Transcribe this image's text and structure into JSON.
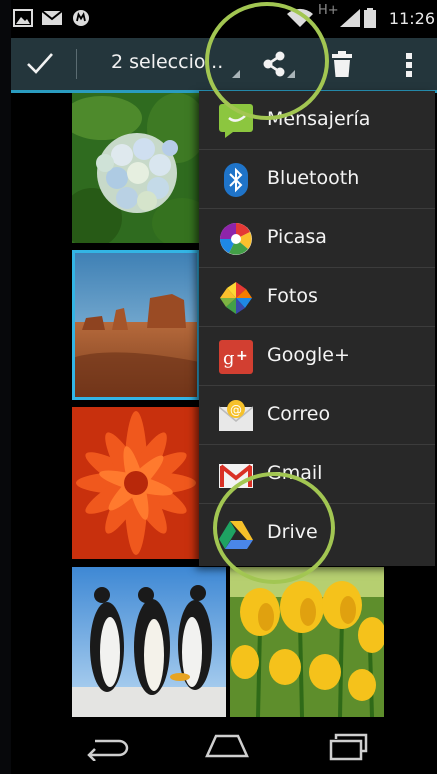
{
  "status_bar": {
    "time": "11:26",
    "network": "H+",
    "icons": [
      "gallery-notification-icon",
      "mail-icon",
      "app-notification-icon",
      "wifi-icon",
      "signal-icon",
      "battery-icon"
    ]
  },
  "action_bar": {
    "done_icon": "check-icon",
    "selection_label": "2 seleccio...",
    "share_icon": "share-icon",
    "delete_icon": "trash-icon",
    "overflow_icon": "more-vert-icon",
    "accent_color": "#33b5e5",
    "bar_color": "#24363c"
  },
  "share_menu": {
    "items": [
      {
        "label": "Mensajería",
        "icon": "messaging-icon"
      },
      {
        "label": "Bluetooth",
        "icon": "bluetooth-icon"
      },
      {
        "label": "Picasa",
        "icon": "picasa-icon"
      },
      {
        "label": "Fotos",
        "icon": "photos-icon"
      },
      {
        "label": "Google+",
        "icon": "google-plus-icon"
      },
      {
        "label": "Correo",
        "icon": "email-icon"
      },
      {
        "label": "Gmail",
        "icon": "gmail-icon"
      },
      {
        "label": "Drive",
        "icon": "drive-icon"
      }
    ]
  },
  "gallery": {
    "photos": [
      {
        "subject": "hydrangea",
        "selected": false
      },
      {
        "subject": "desert",
        "selected": true
      },
      {
        "subject": "orange-flower",
        "selected": false
      },
      {
        "subject": "penguins",
        "selected": false
      },
      {
        "subject": "tulips",
        "selected": false
      }
    ]
  },
  "nav_bar": {
    "icons": [
      "back-icon",
      "home-icon",
      "recent-apps-icon"
    ]
  },
  "highlight_color": "#a2c652"
}
